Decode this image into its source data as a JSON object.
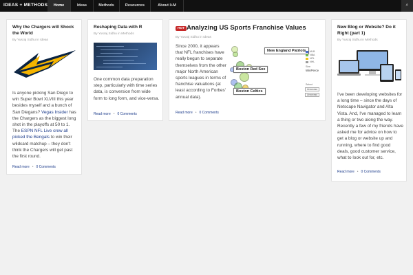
{
  "header": {
    "logo": "IDEAS + METHODS",
    "nav": [
      "Home",
      "Ideas",
      "Methods",
      "Resources",
      "About I+M"
    ],
    "active": "Home",
    "search_icon": "⌕"
  },
  "cards": [
    {
      "title": "Why the Chargers will Shock the World",
      "meta_prefix": "By",
      "author": "Yusraj Sidhu",
      "meta_in": "in",
      "category": "Ideas",
      "image_icon": "lightning-bolt-logo",
      "body_parts": [
        "Is anyone picking San Diego to win Super Bowl XLVIII this year besides myself and a bunch of San Diegans? ",
        "Vegas Insider",
        " has the Chargers as the biggest long shot in the playoffs at 50 to 1. The ",
        "ESPN NFL Live crew all picked the Bengals",
        " to win their wildcard matchup – they don't think the Chargers will get past the first round."
      ],
      "read_more": "Read more",
      "comments": "0 Comments"
    },
    {
      "title": "Reshaping Data with R",
      "meta_prefix": "By",
      "author": "Yusraj Sidhu",
      "meta_in": "in",
      "category": "Methods",
      "body": "One common data preparation step, particularly with time series data, is conversion from wide form to long form, and vice-versa.",
      "read_more": "Read more",
      "comments": "0 Comments"
    },
    {
      "badge": "HOT",
      "title": "Analyzing US Sports Franchise Values",
      "meta_prefix": "By",
      "author": "Yusraj Sidhu",
      "meta_in": "in",
      "category": "Ideas",
      "body": "Since 2000, it appears that NFL franchises have really begun to separate themselves from the other major North American sports leagues in terms of franchise valuations (at least according to Forbes' annual data).",
      "chart_labels": {
        "team1": "New England Patriots",
        "team2": "Boston Red Sox",
        "team3": "Boston Celtics",
        "legend_items": [
          "MLB",
          "NBA",
          "NFL",
          "NHL"
        ],
        "legend_colors": [
          "#4a6fd0",
          "#6fbf4a",
          "#f0c419",
          "#9a9a9a"
        ],
        "size_label": "Size",
        "size_value": "WinPerce",
        "select_label": "Select",
        "option1": "Unnecess",
        "option2": "Unnecess"
      },
      "read_more": "Read more",
      "comments": "0 Comments"
    },
    {
      "title": "New Blog or Website? Do it Right (part 1)",
      "meta_prefix": "By",
      "author": "Yusraj Sidhu",
      "meta_in": "in",
      "category": "Methods",
      "image_icon": "responsive-devices-image",
      "body": "I've been developing websites for a long time – since the days of Netscape Navigator and Alta Vista. And, I've managed to learn a thing or two along the way. Recently a few of my friends have asked me for advice on how to get a blog or website up and running, where to find good deals, good customer service, what to look out for, etc.",
      "read_more": "Read more",
      "comments": "0 Comments"
    }
  ],
  "colors": {
    "nav_bg": "#111111",
    "link": "#1a3a8a",
    "hot": "#c62828",
    "chargers_navy": "#0a2342",
    "chargers_gold": "#f5b400"
  }
}
